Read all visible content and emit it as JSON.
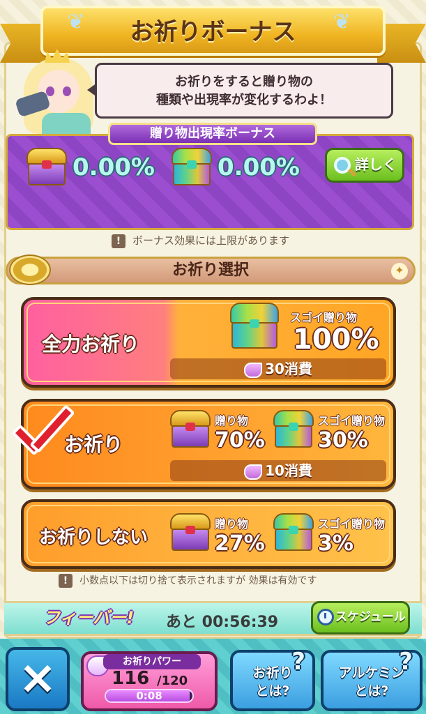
{
  "header": {
    "title": "お祈りボーナス"
  },
  "speech": {
    "line1": "お祈りをすると贈り物の",
    "line2": "種類や出現率が変化するわよ！"
  },
  "bonus": {
    "header": "贈り物出現率ボーナス",
    "gift_rate": "0.00%",
    "super_gift_rate": "0.00%",
    "detail_button": "詳しく",
    "notice": "ボーナス効果には上限があります"
  },
  "section": {
    "title": "お祈り選択"
  },
  "options": [
    {
      "label": "全力お祈り",
      "super_label": "スゴイ贈り物",
      "super_pct": "100%",
      "cost": "30消費",
      "selected": false
    },
    {
      "label": "お祈り",
      "gift_label": "贈り物",
      "gift_pct": "70%",
      "super_label": "スゴイ贈り物",
      "super_pct": "30%",
      "cost": "10消費",
      "selected": true
    },
    {
      "label": "お祈りしない",
      "gift_label": "贈り物",
      "gift_pct": "27%",
      "super_label": "スゴイ贈り物",
      "super_pct": "3%",
      "selected": false
    }
  ],
  "footnote": "小数点以下は切り捨て表示されますが 効果は有効です",
  "fever": {
    "logo": "フィーバー!",
    "remaining": "あと 00:56:39",
    "schedule_button": "スケジュール"
  },
  "bottom": {
    "close_label": "×",
    "power_tag": "お祈りパワー",
    "power_value": "116",
    "power_max": "/120",
    "power_fraction": 0.967,
    "power_timer": "0:08",
    "help1_line1": "お祈り",
    "help1_line2": "とは?",
    "help2_line1": "アルケミン",
    "help2_line2": "とは?"
  },
  "colors": {
    "accent_gold": "#f0b522",
    "bonus_purple": "#9b4fd0",
    "option_full_pink": "#ff5fa0",
    "option_orange": "#ff9a1e",
    "check_red": "#e0202e",
    "fever_teal": "#7edfd0",
    "button_green": "#6bbf1f"
  }
}
